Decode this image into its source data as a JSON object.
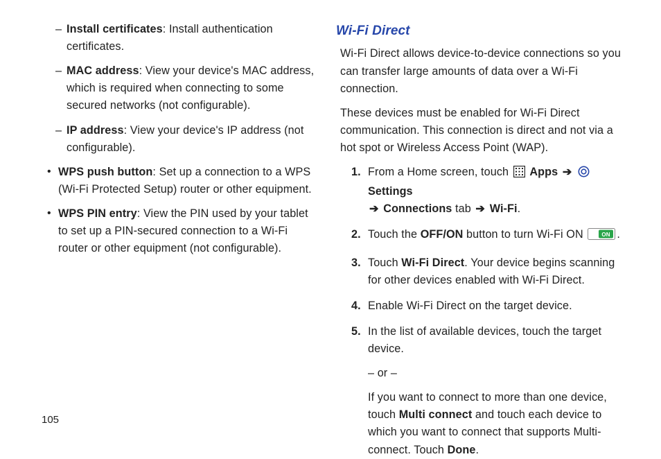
{
  "page_number": "105",
  "left": {
    "dash": [
      {
        "term": "Install certificates",
        "rest": ": Install authentication certificates."
      },
      {
        "term": "MAC address",
        "rest": ": View your device's MAC address, which is required when connecting to some secured networks (not configurable)."
      },
      {
        "term": "IP address",
        "rest": ": View your device's IP address (not configurable)."
      }
    ],
    "bullets": [
      {
        "term": "WPS push button",
        "rest": ": Set up a connection to a WPS (Wi-Fi Protected Setup) router or other equipment."
      },
      {
        "term": "WPS PIN entry",
        "rest": ": View the PIN used by your tablet to set up a PIN-secured connection to a Wi-Fi router or other equipment (not configurable)."
      }
    ]
  },
  "right": {
    "heading": "Wi-Fi Direct",
    "intro1": "Wi-Fi Direct allows device-to-device connections so you can transfer large amounts of data over a Wi-Fi connection.",
    "intro2": "These devices must be enabled for Wi-Fi Direct communication. This connection is direct and not via a hot spot or Wireless Access Point (WAP).",
    "step1": {
      "pre": "From a Home screen, touch ",
      "apps": "Apps",
      "settings": "Settings",
      "connections": "Connections",
      "tab": " tab ",
      "wifi": "Wi-Fi",
      "dot": "."
    },
    "step2": {
      "pre": "Touch the ",
      "offon": "OFF/ON",
      "post": " button to turn Wi-Fi ON ",
      "dot": "."
    },
    "step3": {
      "pre": "Touch ",
      "wfd": "Wi-Fi Direct",
      "post": ". Your device begins scanning for other devices enabled with Wi-Fi Direct."
    },
    "step4": "Enable Wi-Fi Direct on the target device.",
    "step5": {
      "line": "In the list of available devices, touch the target device.",
      "or": "– or –",
      "p1": "If you want to connect to more than one device, touch ",
      "multi": "Multi connect",
      "p2": " and touch each device to which you want to connect that supports Multi-connect. Touch ",
      "done": "Done",
      "p3": "."
    }
  }
}
